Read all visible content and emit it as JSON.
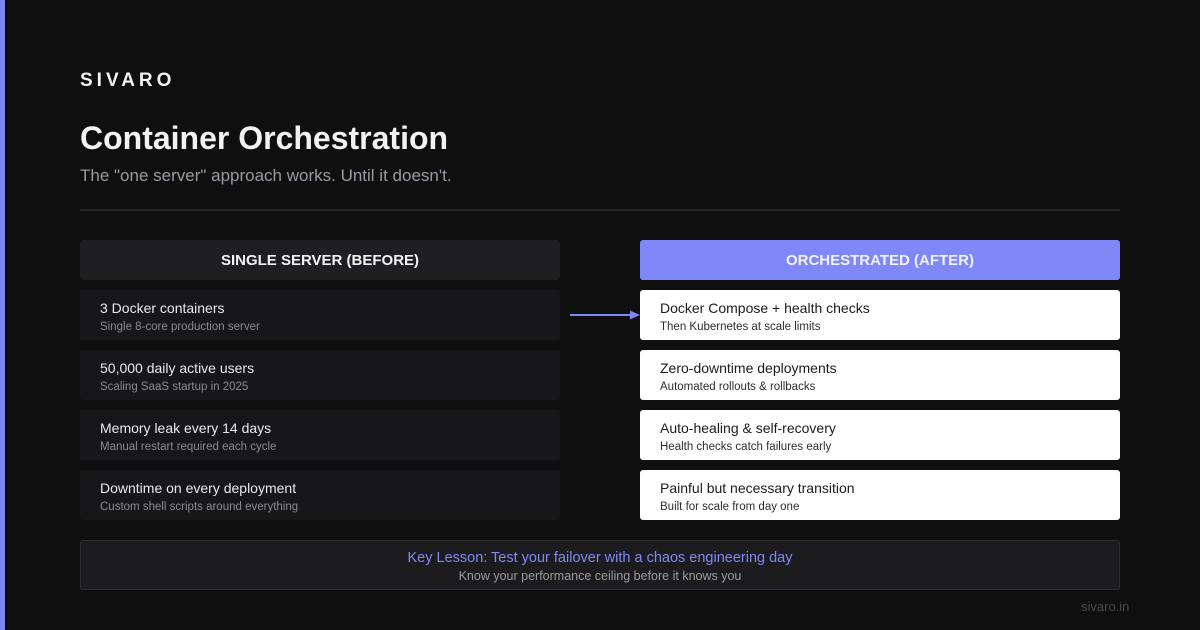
{
  "brand": "SIVARO",
  "title": "Container Orchestration",
  "subtitle": "The \"one server\" approach works. Until it doesn't.",
  "before": {
    "header": "SINGLE SERVER (BEFORE)",
    "items": [
      {
        "main": "3 Docker containers",
        "sub": "Single 8-core production server"
      },
      {
        "main": "50,000 daily active users",
        "sub": "Scaling SaaS startup in 2025"
      },
      {
        "main": "Memory leak every 14 days",
        "sub": "Manual restart required each cycle"
      },
      {
        "main": "Downtime on every deployment",
        "sub": "Custom shell scripts around everything"
      }
    ]
  },
  "after": {
    "header": "ORCHESTRATED (AFTER)",
    "items": [
      {
        "main": "Docker Compose + health checks",
        "sub": "Then Kubernetes at scale limits"
      },
      {
        "main": "Zero-downtime deployments",
        "sub": "Automated rollouts & rollbacks"
      },
      {
        "main": "Auto-healing & self-recovery",
        "sub": "Health checks catch failures early"
      },
      {
        "main": "Painful but necessary transition",
        "sub": "Built for scale from day one"
      }
    ]
  },
  "lesson": {
    "lead": "Key Lesson: Test your failover with a chaos engineering day",
    "follow": "Know your performance ceiling before it knows you"
  },
  "footer": "sivaro.in",
  "colors": {
    "accent": "#7e88f7",
    "background": "#0f0f10"
  }
}
